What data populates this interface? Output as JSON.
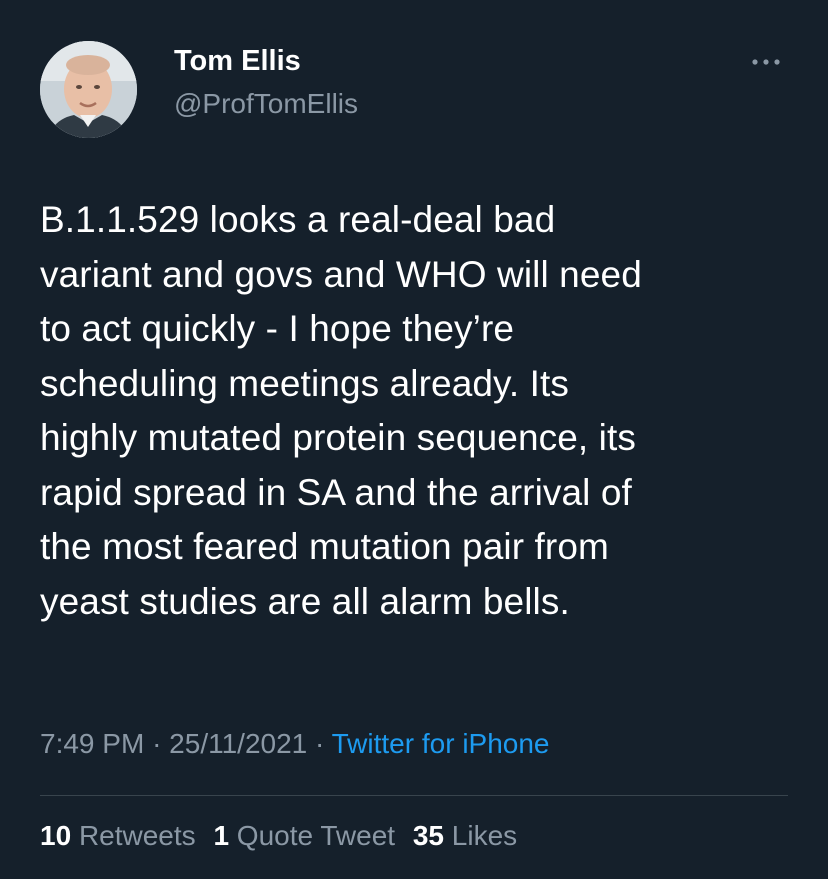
{
  "user": {
    "display_name": "Tom Ellis",
    "handle": "@ProfTomEllis",
    "avatar_icon": "profile-photo"
  },
  "more_icon": "more-horizontal-icon",
  "tweet": {
    "lines": [
      "B.1.1.529 looks a real-deal bad",
      "variant and govs and WHO will need",
      "to act quickly - I hope they’re",
      "scheduling meetings already. Its",
      "highly mutated protein sequence, its",
      "rapid spread in SA and the arrival of",
      "the most feared mutation pair from",
      "yeast studies are all alarm bells."
    ]
  },
  "meta": {
    "time": "7:49 PM",
    "date": "25/11/2021",
    "separator": "·",
    "source": "Twitter for iPhone"
  },
  "stats": {
    "retweets_count": "10",
    "retweets_label": "Retweets",
    "quotes_count": "1",
    "quotes_label": "Quote Tweet",
    "likes_count": "35",
    "likes_label": "Likes"
  },
  "colors": {
    "background": "#15202b",
    "text": "#ffffff",
    "secondary_text": "#8b98a5",
    "link": "#1d9bf0",
    "divider": "#38444d"
  }
}
